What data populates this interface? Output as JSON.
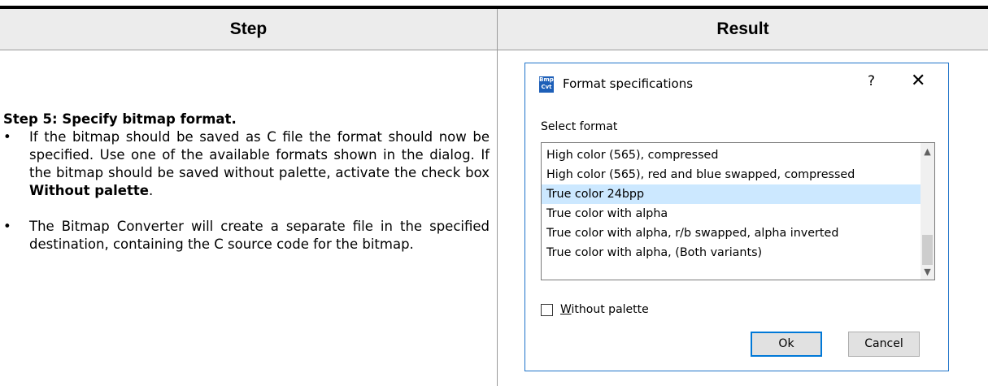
{
  "table": {
    "header_step": "Step",
    "header_result": "Result"
  },
  "step": {
    "title": "Step 5: Specify bitmap format.",
    "bullet1_text": "If the bitmap should be saved as C file the format should now be specified. Use one of the available formats shown in the dialog. If the bitmap should be saved without palette, activate the check box ",
    "bullet1_bold": "Without palette",
    "bullet1_end": ".",
    "bullet2_text": "The Bitmap Converter will create a separate file in the specified destination, containing the C source code for the bitmap.",
    "bullet_symbol": "•"
  },
  "dialog": {
    "icon_text_top": "Bmp",
    "icon_text_bottom": "Cvt",
    "title": "Format specifications",
    "help_label": "?",
    "close_label": "✕",
    "select_label": "Select format",
    "formats": [
      "High color (565), compressed",
      "High color (565), red and blue swapped, compressed",
      "True color 24bpp",
      "True color with alpha",
      "True color with alpha, r/b swapped, alpha inverted",
      "True color with alpha, (Both variants)"
    ],
    "selected_format": "True color 24bpp",
    "checkbox_mnemonic": "W",
    "checkbox_rest": "ithout palette",
    "checkbox_checked": false,
    "ok_label": "Ok",
    "cancel_label": "Cancel",
    "selection_color": "#cce8ff",
    "border_color": "#1f74c9"
  }
}
